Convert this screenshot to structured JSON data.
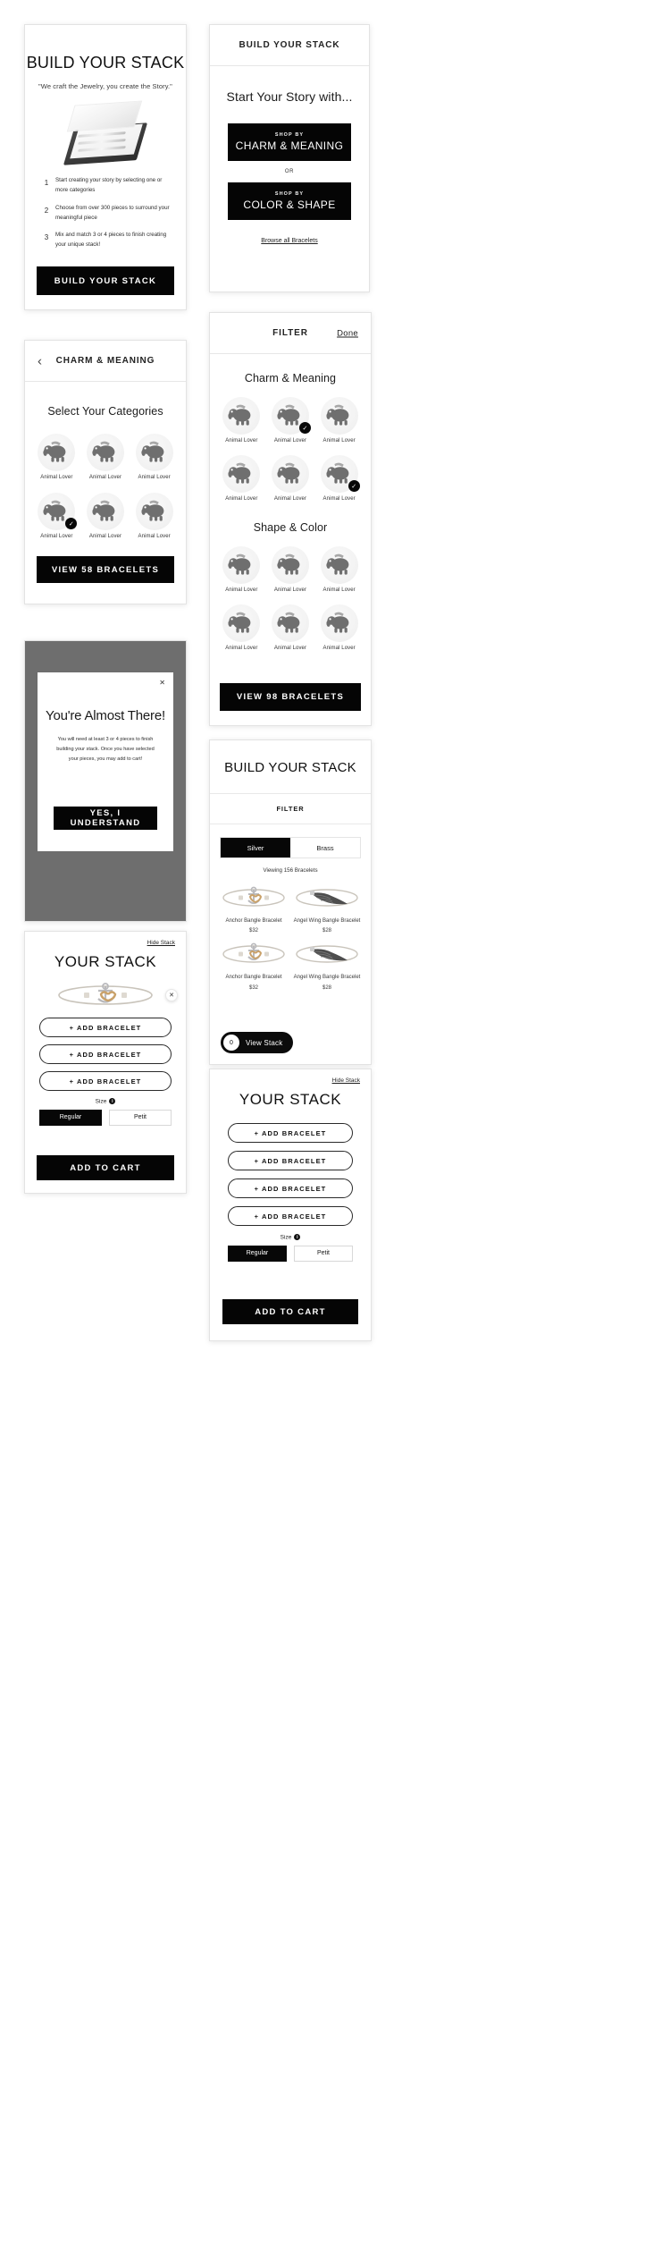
{
  "intro": {
    "title": "BUILD YOUR STACK",
    "quote": "\"We craft the Jewelry, you create the Story.\"",
    "steps": [
      {
        "num": "1",
        "text": "Start creating your story by selecting one or more categories"
      },
      {
        "num": "2",
        "text": "Choose from over 300 pieces to surround your meaningful piece"
      },
      {
        "num": "3",
        "text": "Mix and match 3 or 4 pieces to finish creating your unique stack!"
      }
    ],
    "cta": "BUILD YOUR STACK"
  },
  "story": {
    "header": "BUILD YOUR STACK",
    "title": "Start Your Story with...",
    "shop_by_label": "SHOP BY",
    "option_charm": "CHARM & MEANING",
    "or": "OR",
    "option_color": "COLOR & SHAPE",
    "browse_link": "Browse all Bracelets"
  },
  "categories": {
    "header": "CHARM & MEANING",
    "back_icon": "chevron-left-icon",
    "title": "Select Your Categories",
    "items": [
      {
        "label": "Animal Lover",
        "selected": false
      },
      {
        "label": "Animal Lover",
        "selected": false
      },
      {
        "label": "Animal Lover",
        "selected": false
      },
      {
        "label": "Animal Lover",
        "selected": true
      },
      {
        "label": "Animal Lover",
        "selected": false
      },
      {
        "label": "Animal Lover",
        "selected": false
      }
    ],
    "cta": "VIEW 58 BRACELETS"
  },
  "filter": {
    "header": "FILTER",
    "done": "Done",
    "section1_title": "Charm & Meaning",
    "section1_items": [
      {
        "label": "Animal Lover",
        "selected": false
      },
      {
        "label": "Animal Lover",
        "selected": true
      },
      {
        "label": "Animal Lover",
        "selected": false
      },
      {
        "label": "Animal Lover",
        "selected": false
      },
      {
        "label": "Animal Lover",
        "selected": false
      },
      {
        "label": "Animal Lover",
        "selected": true
      }
    ],
    "section2_title": "Shape & Color",
    "section2_items": [
      {
        "label": "Animal Lover",
        "selected": false
      },
      {
        "label": "Animal Lover",
        "selected": false
      },
      {
        "label": "Animal Lover",
        "selected": false
      },
      {
        "label": "Animal Lover",
        "selected": false
      },
      {
        "label": "Animal Lover",
        "selected": false
      },
      {
        "label": "Animal Lover",
        "selected": false
      }
    ],
    "cta": "VIEW 98 BRACELETS"
  },
  "modal": {
    "close_icon": "close-icon",
    "title": "You're Almost There!",
    "body": "You will need at least 3 or 4 pieces to finish building your stack. Once you have selected your pieces, you may add to cart!",
    "cta": "YES, I UNDERSTAND"
  },
  "products": {
    "title": "BUILD YOUR STACK",
    "filter_label": "FILTER",
    "metal_tabs": [
      {
        "label": "Silver",
        "active": true
      },
      {
        "label": "Brass",
        "active": false
      }
    ],
    "viewing": "Viewing 156 Bracelets",
    "items": [
      {
        "name": "Anchor Bangle Bracelet",
        "price": "$32",
        "art": "anchor"
      },
      {
        "name": "Angel Wing Bangle Bracelet",
        "price": "$28",
        "art": "wing"
      },
      {
        "name": "Anchor Bangle Bracelet",
        "price": "$32",
        "art": "anchor"
      },
      {
        "name": "Angel Wing Bangle Bracelet",
        "price": "$28",
        "art": "wing"
      }
    ],
    "view_stack_count": "0",
    "view_stack_label": "View Stack"
  },
  "stack_small": {
    "hide_link": "Hide Stack",
    "title": "YOUR STACK",
    "remove_icon": "close-icon",
    "add_buttons": [
      "+ ADD BRACELET",
      "+ ADD BRACELET",
      "+ ADD BRACELET"
    ],
    "size_label": "Size",
    "size_options": [
      {
        "label": "Regular",
        "active": true
      },
      {
        "label": "Petit",
        "active": false
      }
    ],
    "cta": "ADD TO CART"
  },
  "stack_large": {
    "hide_link": "Hide Stack",
    "title": "YOUR STACK",
    "add_buttons": [
      "+ ADD BRACELET",
      "+ ADD BRACELET",
      "+ ADD BRACELET",
      "+ ADD BRACELET"
    ],
    "size_label": "Size",
    "size_options": [
      {
        "label": "Regular",
        "active": true
      },
      {
        "label": "Petit",
        "active": false
      }
    ],
    "cta": "ADD TO CART"
  },
  "colors": {
    "accent": "#050505",
    "page_bg": "#ffffff",
    "overlay": "#6e6e6e",
    "border": "#e3e3e3"
  }
}
